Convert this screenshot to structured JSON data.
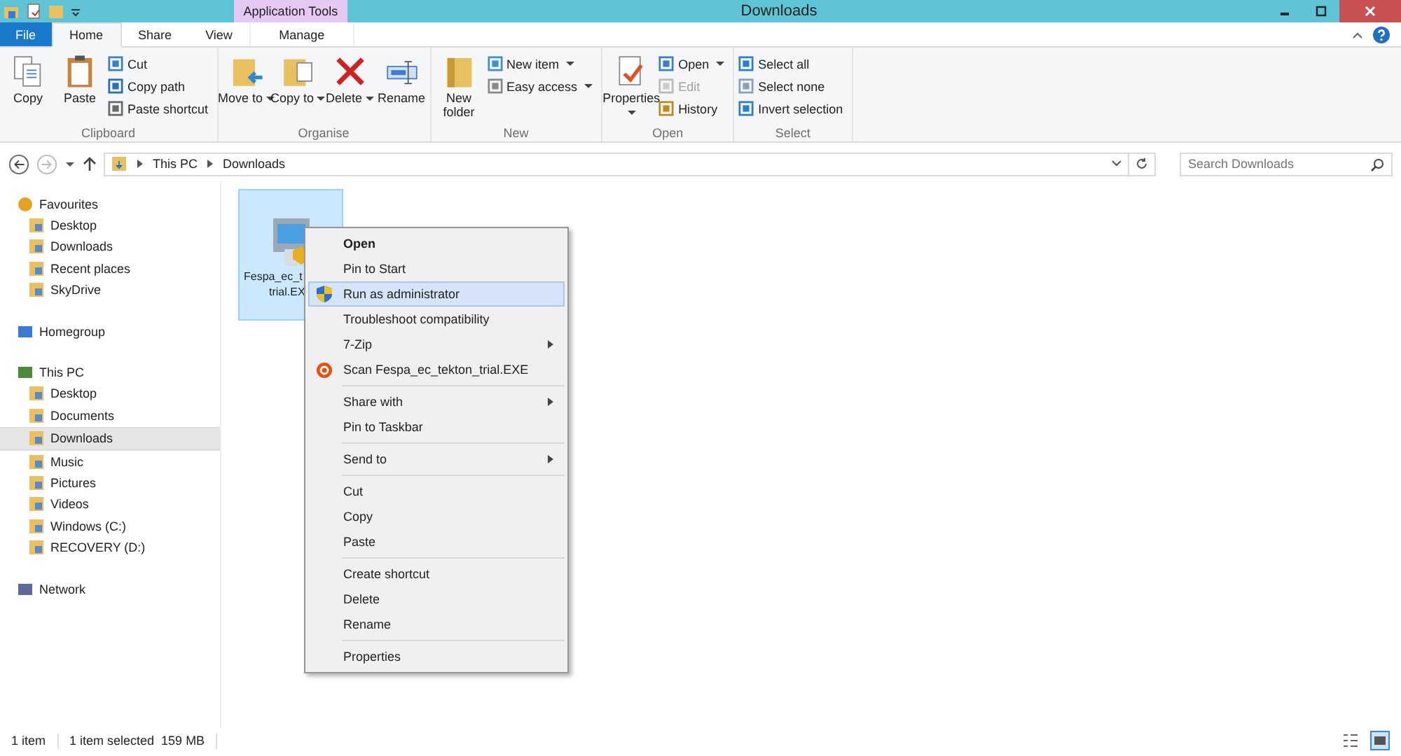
{
  "window": {
    "title": "Downloads",
    "context_tab": "Application Tools"
  },
  "tabs": [
    {
      "label": "File",
      "kind": "file",
      "selected": false
    },
    {
      "label": "Home",
      "kind": "tab",
      "selected": true
    },
    {
      "label": "Share",
      "kind": "tab",
      "selected": false
    },
    {
      "label": "View",
      "kind": "tab",
      "selected": false
    },
    {
      "label": "Manage",
      "kind": "context",
      "selected": false
    }
  ],
  "ribbon": [
    {
      "label": "Clipboard",
      "items": [
        {
          "label": "Copy",
          "kind": "large",
          "dropdown": false
        },
        {
          "label": "Paste",
          "kind": "large",
          "dropdown": false
        },
        {
          "label": "Cut",
          "kind": "small",
          "dropdown": false,
          "disabled": false
        },
        {
          "label": "Copy path",
          "kind": "small",
          "dropdown": false,
          "disabled": false
        },
        {
          "label": "Paste shortcut",
          "kind": "small",
          "dropdown": false,
          "disabled": false
        }
      ]
    },
    {
      "label": "Organise",
      "items": [
        {
          "label": "Move to",
          "kind": "large",
          "dropdown": true
        },
        {
          "label": "Copy to",
          "kind": "large",
          "dropdown": true
        },
        {
          "label": "Delete",
          "kind": "large",
          "dropdown": true
        },
        {
          "label": "Rename",
          "kind": "large",
          "dropdown": false
        }
      ]
    },
    {
      "label": "New",
      "items": [
        {
          "label": "New folder",
          "kind": "large",
          "dropdown": false
        },
        {
          "label": "New item",
          "kind": "small",
          "dropdown": true,
          "disabled": false
        },
        {
          "label": "Easy access",
          "kind": "small",
          "dropdown": true,
          "disabled": false
        }
      ]
    },
    {
      "label": "Open",
      "items": [
        {
          "label": "Properties",
          "kind": "large",
          "dropdown": true
        },
        {
          "label": "Open",
          "kind": "small",
          "dropdown": true,
          "disabled": false
        },
        {
          "label": "Edit",
          "kind": "small",
          "dropdown": false,
          "disabled": true
        },
        {
          "label": "History",
          "kind": "small",
          "dropdown": false,
          "disabled": false
        }
      ]
    },
    {
      "label": "Select",
      "items": [
        {
          "label": "Select all",
          "kind": "small",
          "dropdown": false,
          "disabled": false
        },
        {
          "label": "Select none",
          "kind": "small",
          "dropdown": false,
          "disabled": false
        },
        {
          "label": "Invert selection",
          "kind": "small",
          "dropdown": false,
          "disabled": false
        }
      ]
    }
  ],
  "address": {
    "path": [
      "This PC",
      "Downloads"
    ],
    "search": {
      "placeholder": "Search Downloads"
    }
  },
  "sidebar": [
    {
      "label": "Favourites",
      "selected": false,
      "children": [
        {
          "label": "Desktop",
          "selected": false
        },
        {
          "label": "Downloads",
          "selected": false
        },
        {
          "label": "Recent places",
          "selected": false
        },
        {
          "label": "SkyDrive",
          "selected": false
        }
      ]
    },
    {
      "label": "Homegroup",
      "selected": false
    },
    {
      "label": "This PC",
      "selected": false,
      "children": [
        {
          "label": "Desktop",
          "selected": false
        },
        {
          "label": "Documents",
          "selected": false
        },
        {
          "label": "Downloads",
          "selected": true
        },
        {
          "label": "Music",
          "selected": false
        },
        {
          "label": "Pictures",
          "selected": false
        },
        {
          "label": "Videos",
          "selected": false
        },
        {
          "label": "Windows (C:)",
          "selected": false
        },
        {
          "label": "RECOVERY (D:)",
          "selected": false
        }
      ]
    },
    {
      "label": "Network",
      "selected": false
    }
  ],
  "files": [
    {
      "name_lines": [
        "Fespa_ec_t",
        "trial.EX"
      ],
      "selected": true
    }
  ],
  "context_menu": [
    [
      {
        "label": "Open",
        "default": true,
        "submenu": false,
        "selected": false
      },
      {
        "label": "Pin to Start",
        "default": false,
        "submenu": false,
        "selected": false
      },
      {
        "label": "Run as administrator",
        "default": false,
        "submenu": false,
        "selected": true
      },
      {
        "label": "Troubleshoot compatibility",
        "default": false,
        "submenu": false,
        "selected": false
      },
      {
        "label": "7-Zip",
        "default": false,
        "submenu": true,
        "selected": false
      },
      {
        "label": "Scan Fespa_ec_tekton_trial.EXE",
        "default": false,
        "submenu": false,
        "selected": false
      }
    ],
    [
      {
        "label": "Share with",
        "default": false,
        "submenu": true,
        "selected": false
      },
      {
        "label": "Pin to Taskbar",
        "default": false,
        "submenu": false,
        "selected": false
      }
    ],
    [
      {
        "label": "Send to",
        "default": false,
        "submenu": true,
        "selected": false
      }
    ],
    [
      {
        "label": "Cut",
        "default": false,
        "submenu": false,
        "selected": false
      },
      {
        "label": "Copy",
        "default": false,
        "submenu": false,
        "selected": false
      },
      {
        "label": "Paste",
        "default": false,
        "submenu": false,
        "selected": false
      }
    ],
    [
      {
        "label": "Create shortcut",
        "default": false,
        "submenu": false,
        "selected": false
      },
      {
        "label": "Delete",
        "default": false,
        "submenu": false,
        "selected": false
      },
      {
        "label": "Rename",
        "default": false,
        "submenu": false,
        "selected": false
      }
    ],
    [
      {
        "label": "Properties",
        "default": false,
        "submenu": false,
        "selected": false
      }
    ]
  ],
  "status_bar": {
    "count": "1 item",
    "selection": "1 item selected",
    "size": "159 MB"
  }
}
